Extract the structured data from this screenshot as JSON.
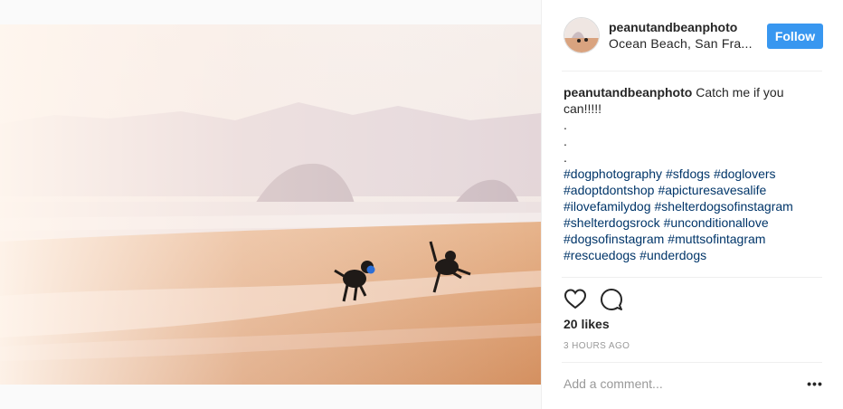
{
  "post": {
    "username": "peanutandbeanphoto",
    "location": "Ocean Beach, San Fra...",
    "follow_label": "Follow",
    "caption_text": "Catch me if you can!!!!!",
    "caption_dots": [
      ".",
      ".",
      "."
    ],
    "hashtags": [
      "#dogphotography",
      "#sfdogs",
      "#doglovers",
      "#adoptdontshop",
      "#apicturesavesalife",
      "#ilovefamilydog",
      "#shelterdogsofinstagram",
      "#shelterdogsrock",
      "#unconditionallove",
      "#dogsofinstagram",
      "#muttsofintagram",
      "#rescuedogs",
      "#underdogs"
    ],
    "likes": "20 likes",
    "time": "3 HOURS AGO",
    "comment_placeholder": "Add a comment...",
    "more_label": "•••"
  },
  "icons": {
    "like": "heart-outline-icon",
    "comment": "speech-bubble-icon",
    "more": "ellipsis-icon"
  },
  "colors": {
    "follow_button": "#3897f0",
    "hashtag": "#003569",
    "muted": "#999999"
  }
}
